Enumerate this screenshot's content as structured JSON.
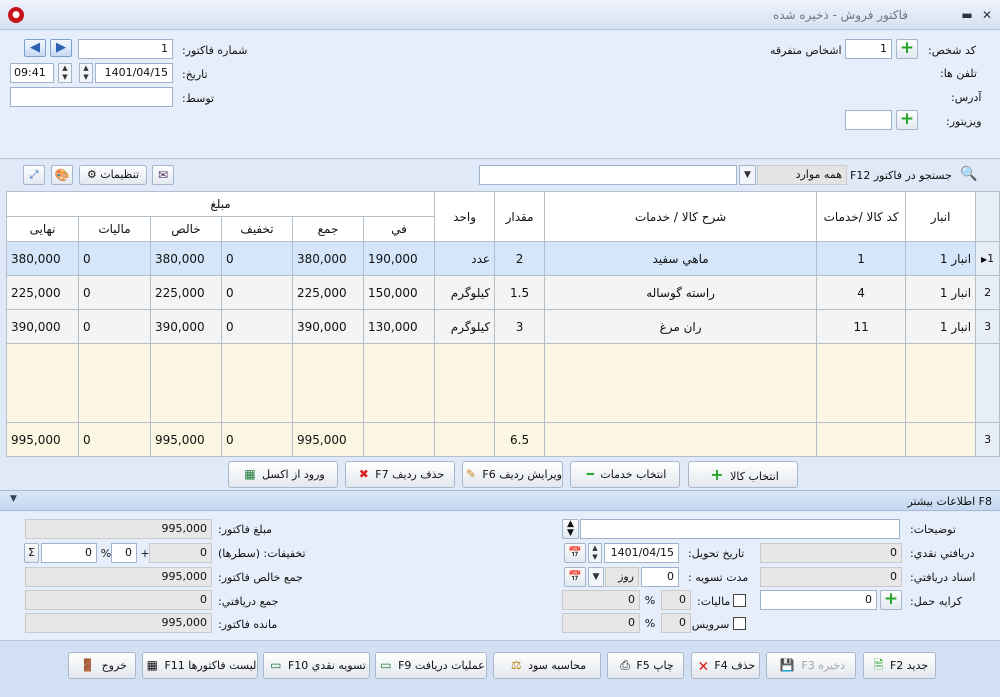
{
  "window": {
    "title": "فاکتور فروش - ذخیره شده",
    "app_icon_glyph": "●",
    "min_glyph": "▬",
    "close_glyph": "✕"
  },
  "header": {
    "person_code_label": "کد شخص:",
    "person_code": "1",
    "person_name": "اشخاص متفرقه",
    "phones_label": "تلفن ها:",
    "address_label": "آدرس:",
    "visitor_label": "ویزیتور:",
    "visitor_value": "",
    "invoice_no_label": "شماره فاکتور:",
    "invoice_no": "1",
    "date_label": "تاریخ:",
    "date": "1401/04/15",
    "time": "09:41",
    "by_label": "توسط:",
    "by_value": ""
  },
  "toolbar": {
    "search_label": "جستجو در فاکتور F12",
    "search_filter": "همه موارد",
    "search_value": "",
    "settings_label": "تنظیمات"
  },
  "table": {
    "headers": {
      "warehouse": "انبار",
      "code": "کد کالا /خدمات",
      "desc": "شرح کالا / خدمات",
      "qty": "مقدار",
      "unit": "واحد",
      "amount_group": "مبلغ",
      "unit_price": "في",
      "total": "جمع",
      "discount": "تخفيف",
      "net": "خالص",
      "tax": "ماليات",
      "final": "نهایی"
    },
    "rows": [
      {
        "idx": "1",
        "marker": "▶",
        "warehouse": "انبار 1",
        "code": "1",
        "desc": "ماهي سفيد",
        "qty": "2",
        "unit": "عدد",
        "unit_price": "190,000",
        "total": "380,000",
        "discount": "0",
        "net": "380,000",
        "tax": "0",
        "final": "380,000"
      },
      {
        "idx": "2",
        "marker": "",
        "warehouse": "انبار 1",
        "code": "4",
        "desc": "راسته گوساله",
        "qty": "1.5",
        "unit": "کيلوگرم",
        "unit_price": "150,000",
        "total": "225,000",
        "discount": "0",
        "net": "225,000",
        "tax": "0",
        "final": "225,000"
      },
      {
        "idx": "3",
        "marker": "",
        "warehouse": "انبار 1",
        "code": "11",
        "desc": "ران مرغ",
        "qty": "3",
        "unit": "کيلوگرم",
        "unit_price": "130,000",
        "total": "390,000",
        "discount": "0",
        "net": "390,000",
        "tax": "0",
        "final": "390,000"
      }
    ],
    "footer": {
      "idx": "3",
      "qty": "6.5",
      "total": "995,000",
      "discount": "0",
      "net": "995,000",
      "tax": "0",
      "final": "995,000"
    }
  },
  "row_actions": {
    "select_goods": "انتخاب کالا",
    "select_services": "انتخاب خدمات",
    "edit_row": "ویرایش ردیف F6",
    "delete_row": "حذف ردیف F7",
    "import_excel": "ورود از اکسل"
  },
  "more_info": {
    "title": "F8 اطلاعات بيشتر"
  },
  "details": {
    "description_label": "توضيحات:",
    "description": "",
    "cash_received_label": "دريافتي نقدي:",
    "cash_received": "0",
    "delivery_date_label": "تاريخ تحويل:",
    "delivery_date": "1401/04/15",
    "checks_label": "اسناد دريافتي:",
    "checks": "0",
    "settlement_label": "مدت تسويه :",
    "settlement_value": "0",
    "settlement_unit": "روز",
    "freight_label": "کرايه حمل:",
    "freight": "0",
    "tax_label": "ماليات:",
    "tax_pct": "0",
    "tax_amount": "0",
    "service_label": "سرويس:",
    "service_pct": "0",
    "service_amount": "0",
    "invoice_amount_label": "مبلغ فاکتور:",
    "invoice_amount": "995,000",
    "discounts_label": "تخفيفات: (سطرها)",
    "discount_rows": "0",
    "discount_pct": "0",
    "discount_extra": "0",
    "net_total_label": "جمع خالص فاکتور:",
    "net_total": "995,000",
    "total_received_label": "جمع دريافتي:",
    "total_received": "0",
    "remaining_label": "مانده فاکتور:",
    "remaining": "995,000",
    "percent": "%",
    "plus": "+",
    "sigma": "Σ"
  },
  "bottom": {
    "new": "جديد F2",
    "save": "ذخيره F3",
    "delete": "حذف F4",
    "print": "چاپ F5",
    "profit": "محاسبه سود",
    "receive_ops": "عمليات دريافت F9",
    "cash_settle": "تسويه نقدي F10",
    "invoice_list": "ليست فاکتورها F11",
    "exit": "خروج"
  }
}
